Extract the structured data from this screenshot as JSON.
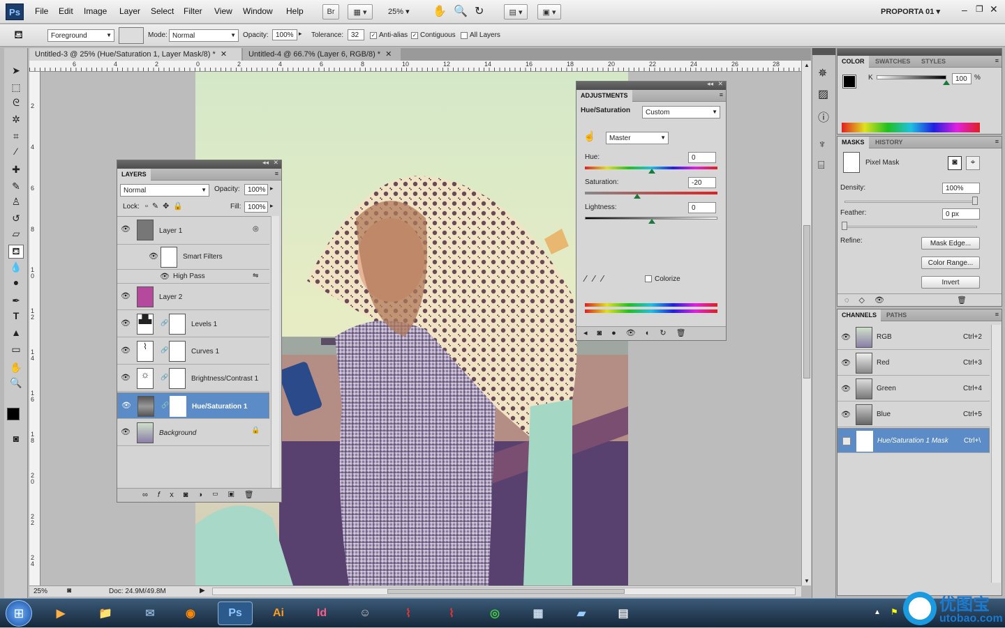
{
  "menubar": {
    "logo": "Ps",
    "items": [
      "File",
      "Edit",
      "Image",
      "Layer",
      "Select",
      "Filter",
      "View",
      "Window",
      "Help"
    ],
    "bridge_label": "Br",
    "zoom": "25%",
    "workspace": "PROPORTA 01"
  },
  "options": {
    "fill_source": "Foreground",
    "mode_label": "Mode:",
    "mode_value": "Normal",
    "opacity_label": "Opacity:",
    "opacity_value": "100%",
    "tolerance_label": "Tolerance:",
    "tolerance_value": "32",
    "antialias_label": "Anti-alias",
    "contiguous_label": "Contiguous",
    "all_layers_label": "All Layers"
  },
  "tabs": [
    {
      "label": "Untitled-3 @ 25% (Hue/Saturation 1, Layer Mask/8) *"
    },
    {
      "label": "Untitled-4 @ 66.7% (Layer 6, RGB/8) *"
    }
  ],
  "ruler": {
    "h": [
      "6",
      "4",
      "2",
      "0",
      "2",
      "4",
      "6",
      "8",
      "10",
      "12",
      "14",
      "16",
      "18",
      "20",
      "22",
      "24",
      "26",
      "28"
    ],
    "v": [
      "2",
      "4",
      "6",
      "8",
      "1\n0",
      "1\n2",
      "1\n4",
      "1\n6",
      "1\n8",
      "2\n0",
      "2\n2",
      "2\n4"
    ]
  },
  "status": {
    "zoom": "25%",
    "doc": "Doc: 24.9M/49.8M"
  },
  "layers_panel": {
    "title": "LAYERS",
    "blend_mode": "Normal",
    "opacity_label": "Opacity:",
    "opacity_value": "100%",
    "lock_label": "Lock:",
    "fill_label": "Fill:",
    "fill_value": "100%",
    "layers": [
      {
        "name": "Layer 1",
        "sub": "Smart Filters",
        "filter": "High Pass"
      },
      {
        "name": "Layer 2"
      },
      {
        "name": "Levels 1"
      },
      {
        "name": "Curves 1"
      },
      {
        "name": "Brightness/Contrast 1"
      },
      {
        "name": "Hue/Saturation 1"
      },
      {
        "name": "Background"
      }
    ]
  },
  "adjustments": {
    "title": "ADJUSTMENTS",
    "name": "Hue/Saturation",
    "preset": "Custom",
    "channel": "Master",
    "hue_label": "Hue:",
    "hue_value": "0",
    "saturation_label": "Saturation:",
    "saturation_value": "-20",
    "lightness_label": "Lightness:",
    "lightness_value": "0",
    "colorize_label": "Colorize"
  },
  "color_panel": {
    "tabs": [
      "COLOR",
      "SWATCHES",
      "STYLES"
    ],
    "k_label": "K",
    "k_value": "100",
    "pct": "%"
  },
  "masks_panel": {
    "tabs": [
      "MASKS",
      "HISTORY"
    ],
    "pixel_mask": "Pixel Mask",
    "density_label": "Density:",
    "density_value": "100%",
    "feather_label": "Feather:",
    "feather_value": "0 px",
    "refine_label": "Refine:",
    "mask_edge": "Mask Edge...",
    "color_range": "Color Range...",
    "invert": "Invert"
  },
  "channels_panel": {
    "tabs": [
      "CHANNELS",
      "PATHS"
    ],
    "channels": [
      {
        "name": "RGB",
        "shortcut": "Ctrl+2"
      },
      {
        "name": "Red",
        "shortcut": "Ctrl+3"
      },
      {
        "name": "Green",
        "shortcut": "Ctrl+4"
      },
      {
        "name": "Blue",
        "shortcut": "Ctrl+5"
      },
      {
        "name": "Hue/Saturation 1 Mask",
        "shortcut": "Ctrl+\\"
      }
    ]
  },
  "taskbar": {
    "apps": [
      "Ps",
      "Ai",
      "Id"
    ],
    "watermark": "优图宝",
    "watermark_url": "utobao.com"
  },
  "colors": {
    "selection": "#5b8cc8",
    "layer2_swatch": "#b5499d",
    "panel_bg": "#d6d6d6"
  }
}
